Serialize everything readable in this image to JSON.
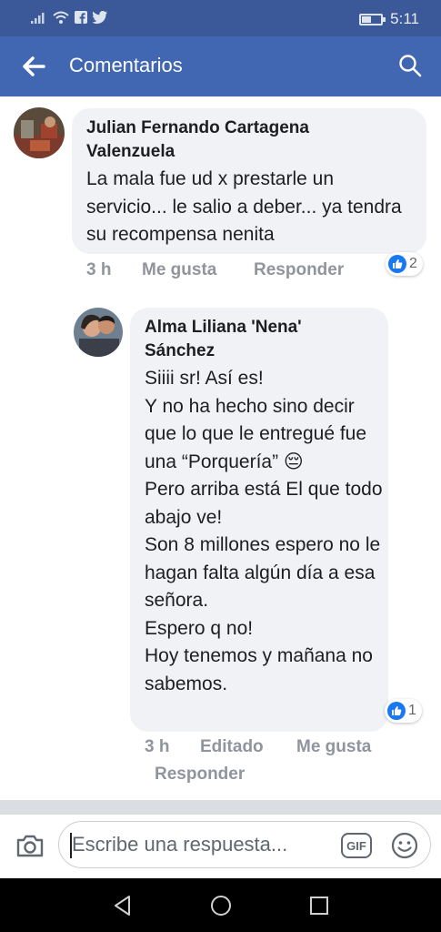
{
  "status_bar": {
    "time": "5:11",
    "icons": [
      "signal-icon",
      "wifi-icon",
      "facebook-icon",
      "twitter-icon",
      "battery-icon"
    ]
  },
  "header": {
    "title": "Comentarios",
    "back_icon": "arrow-left-icon",
    "search_icon": "search-icon"
  },
  "comments": [
    {
      "author": "Julian Fernando Cartagena Valenzuela",
      "text": "La mala fue ud x prestarle un servicio... le salio a deber... ya tendra su recompensa nenita",
      "time": "3 h",
      "like_label": "Me gusta",
      "reply_label": "Responder",
      "reaction_count": "2"
    },
    {
      "author": "Alma Liliana 'Nena' Sánchez",
      "text": "Siiii sr! Así es!\nY no ha hecho sino decir que lo que le entregué fue una “Porquería” 😔\nPero arriba está El que todo abajo ve!\nSon 8 millones espero no le hagan falta algún día a esa señora.\nEspero q no!\nHoy tenemos y mañana no sabemos.",
      "time": "3 h",
      "edited_label": "Editado",
      "like_label": "Me gusta",
      "reply_label": "Responder",
      "reaction_count": "1"
    }
  ],
  "composer": {
    "placeholder": "Escribe una respuesta...",
    "gif_label": "GIF"
  },
  "colors": {
    "status_bar": "#3b5998",
    "app_bar": "#4267b2",
    "bubble": "#f0f2f5",
    "like_blue": "#1877f2",
    "meta_gray": "#90949c"
  }
}
